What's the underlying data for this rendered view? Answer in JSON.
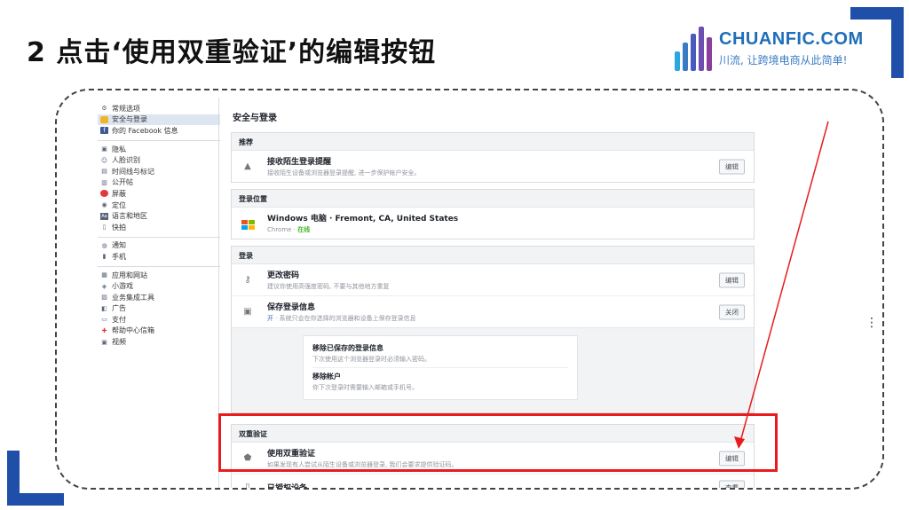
{
  "slide": {
    "title": "2 点击‘使用双重验证’的编辑按钮"
  },
  "brand": {
    "name": "CHUANFIC.COM",
    "slogan": "川流, 让跨境电商从此简单!",
    "colors": [
      "#2aa7e0",
      "#3a7cc4",
      "#4a5bbf",
      "#6c4fb0",
      "#8a3f9c"
    ]
  },
  "sidebar": {
    "items": [
      {
        "label": "常规选项",
        "icon": "gear-icon",
        "active": false
      },
      {
        "label": "安全与登录",
        "icon": "shield-icon",
        "active": true
      },
      {
        "label": "你的 Facebook 信息",
        "icon": "facebook-icon",
        "active": false
      },
      {
        "label": "隐私",
        "icon": "lock-icon",
        "active": false
      },
      {
        "label": "人脸识别",
        "icon": "face-icon",
        "active": false
      },
      {
        "label": "时间线与标记",
        "icon": "timeline-icon",
        "active": false
      },
      {
        "label": "公开帖",
        "icon": "public-post-icon",
        "active": false
      },
      {
        "label": "屏蔽",
        "icon": "block-icon",
        "active": false
      },
      {
        "label": "定位",
        "icon": "location-icon",
        "active": false
      },
      {
        "label": "语言和地区",
        "icon": "language-icon",
        "active": false
      },
      {
        "label": "快拍",
        "icon": "stories-icon",
        "active": false
      },
      {
        "label": "通知",
        "icon": "globe-icon",
        "active": false
      },
      {
        "label": "手机",
        "icon": "phone-icon",
        "active": false
      },
      {
        "label": "应用和网站",
        "icon": "apps-icon",
        "active": false
      },
      {
        "label": "小游戏",
        "icon": "game-icon",
        "active": false
      },
      {
        "label": "业务集成工具",
        "icon": "business-icon",
        "active": false
      },
      {
        "label": "广告",
        "icon": "ads-icon",
        "active": false
      },
      {
        "label": "支付",
        "icon": "payment-icon",
        "active": false
      },
      {
        "label": "帮助中心信箱",
        "icon": "help-icon",
        "active": false
      },
      {
        "label": "视频",
        "icon": "video-icon",
        "active": false
      }
    ]
  },
  "page": {
    "title": "安全与登录",
    "sections": {
      "recommend": {
        "header": "推荐",
        "title": "接收陌生登录提醒",
        "desc": "接收陌生设备或浏览器登录提醒, 进一步保护帐户安全。",
        "button": "编辑"
      },
      "where": {
        "header": "登录位置",
        "device": "Windows 电脑 · Fremont, CA, United States",
        "browser": "Chrome · ",
        "status": "在线"
      },
      "login": {
        "header": "登录",
        "change_pw_title": "更改密码",
        "change_pw_desc": "建议你使用高强度密码, 不要与其他地方重复",
        "change_pw_button": "编辑",
        "save_title": "保存登录信息",
        "save_on": "开",
        "save_desc": " · 系统只会在你选择的浏览器和设备上保存登录信息",
        "save_button": "关闭",
        "remove_saved_title": "移除已保存的登录信息",
        "remove_saved_desc": "下次使用这个浏览器登录时必须输入密码。",
        "remove_account_title": "移除帐户",
        "remove_account_desc": "你下次登录时需要输入邮箱或手机号。"
      },
      "twofactor": {
        "header": "双重验证",
        "title": "使用双重验证",
        "desc": "如果发现有人尝试从陌生设备或浏览器登录, 我们会要求提供验证码。",
        "button": "编辑",
        "next_title": "已授权设备",
        "next_button": "查看"
      }
    }
  },
  "colors": {
    "highlight": "#e81c1c",
    "arrow": "#e81c1c",
    "corner": "#1f4fa8"
  }
}
